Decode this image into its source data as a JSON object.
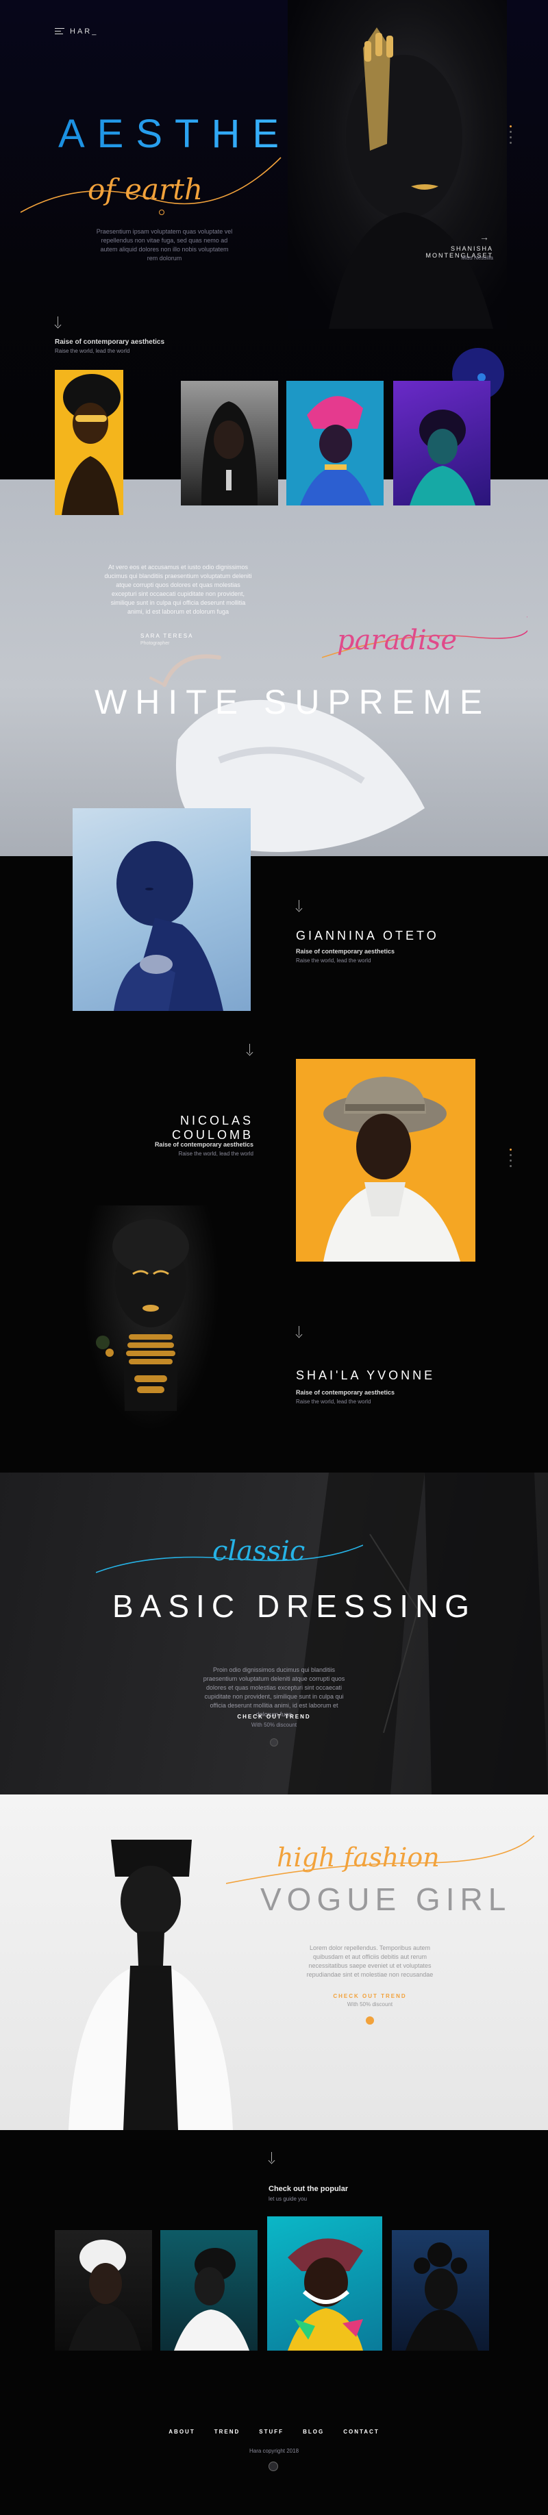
{
  "brand": {
    "logo": "HAR_"
  },
  "hero": {
    "title": "AESTHE",
    "script": "of earth",
    "blurb": "Praesentium ipsam voluptatem quas voluptate vel repellendus non vitae fuga, sed quas nemo ad autem aliquid dolores non illo nobis voluptatem rem dolorum",
    "person_name": "SHANISHA MONTENGLASET",
    "person_role": "Miss Nessilla",
    "colors": {
      "accent": "#f2a23b",
      "blue": "#1e8fd6"
    }
  },
  "intro": {
    "title": "Raise of contemporary aesthetics",
    "sub": "Raise the world, lead the world"
  },
  "white": {
    "quote": "At vero eos et accusamus et iusto odio dignissimos ducimus qui blanditiis praesentium voluptatum deleniti atque corrupti quos dolores et quas molestias excepturi sint occaecati cupiditate non provident, similique sunt in culpa qui officia deserunt mollitia animi, id est laborum et dolorum fuga",
    "author": "SARA TERESA",
    "author_role": "Photographer",
    "script": "paradise",
    "title": "WHITE SUPREME"
  },
  "people": [
    {
      "name": "GIANNINA OTETO",
      "title": "Raise of contemporary aesthetics",
      "sub": "Raise the world, lead the world"
    },
    {
      "name": "NICOLAS COULOMB",
      "title": "Raise of contemporary aesthetics",
      "sub": "Raise the world, lead the world"
    },
    {
      "name": "SHAI'LA YVONNE",
      "title": "Raise of contemporary aesthetics",
      "sub": "Raise the world, lead the world"
    }
  ],
  "classic": {
    "script": "classic",
    "title": "BASIC DRESSING",
    "body": "Proin odio dignissimos ducimus qui blanditiis praesentium voluptatum deleniti atque corrupti quos dolores et quas molestias excepturi sint occaecati cupiditate non provident, similique sunt in culpa qui officia deserunt mollitia animi, id est laborum et dolorum fuga",
    "cta": "CHECK OUT TREND",
    "cta_sub": "With 50% discount"
  },
  "vogue": {
    "script": "high fashion",
    "title": "VOGUE GIRL",
    "body": "Lorem dolor repellendus. Temporibus autem quibusdam et aut officiis debitis aut rerum necessitatibus saepe eveniet ut et voluptates repudiandae sint et molestiae non recusandae",
    "cta": "CHECK OUT TREND",
    "cta_sub": "With 50% discount"
  },
  "popular": {
    "title": "Check out the popular",
    "sub": "let us guide you"
  },
  "footer": {
    "nav": [
      "ABOUT",
      "TREND",
      "STUFF",
      "BLOG",
      "CONTACT"
    ],
    "copyright": "Hara copyright 2018"
  }
}
